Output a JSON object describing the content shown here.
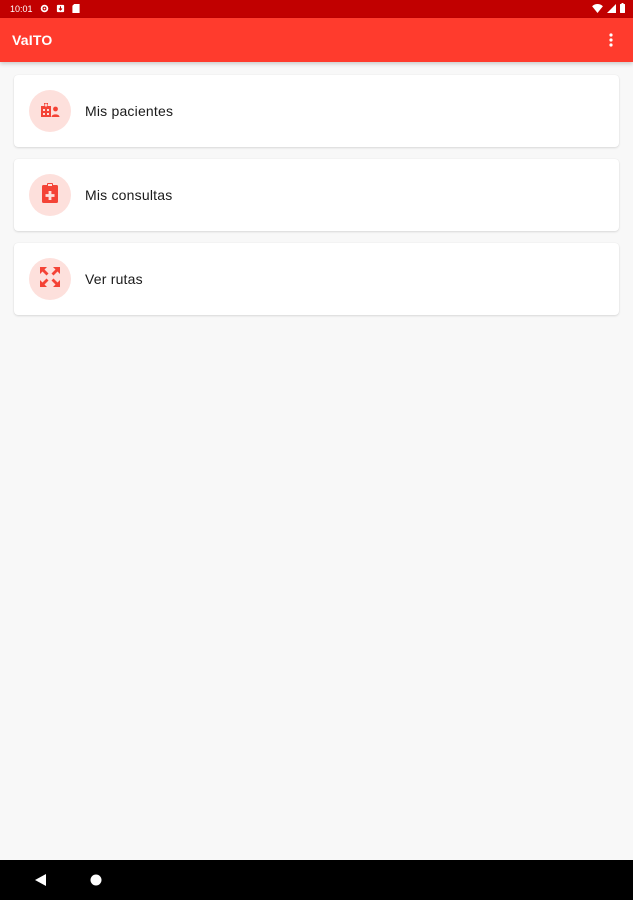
{
  "status_bar": {
    "time": "10:01",
    "icons_left": [
      "gear-icon",
      "download-icon",
      "sd-card-icon"
    ],
    "icons_right": [
      "wifi-icon",
      "signal-icon",
      "battery-icon"
    ]
  },
  "app_bar": {
    "title": "VaITO",
    "menu_icon": "more-vert-icon"
  },
  "menu": {
    "items": [
      {
        "label": "Mis pacientes",
        "icon": "patients-icon"
      },
      {
        "label": "Mis consultas",
        "icon": "clipboard-medical-icon"
      },
      {
        "label": "Ver rutas",
        "icon": "routes-icon"
      }
    ]
  },
  "nav_bar": {
    "buttons": [
      "back-icon",
      "home-icon"
    ]
  },
  "colors": {
    "status_bar": "#c10000",
    "app_bar": "#ff3b2d",
    "accent": "#f44336",
    "icon_bg": "#fde0dc",
    "background": "#f8f8f8"
  }
}
